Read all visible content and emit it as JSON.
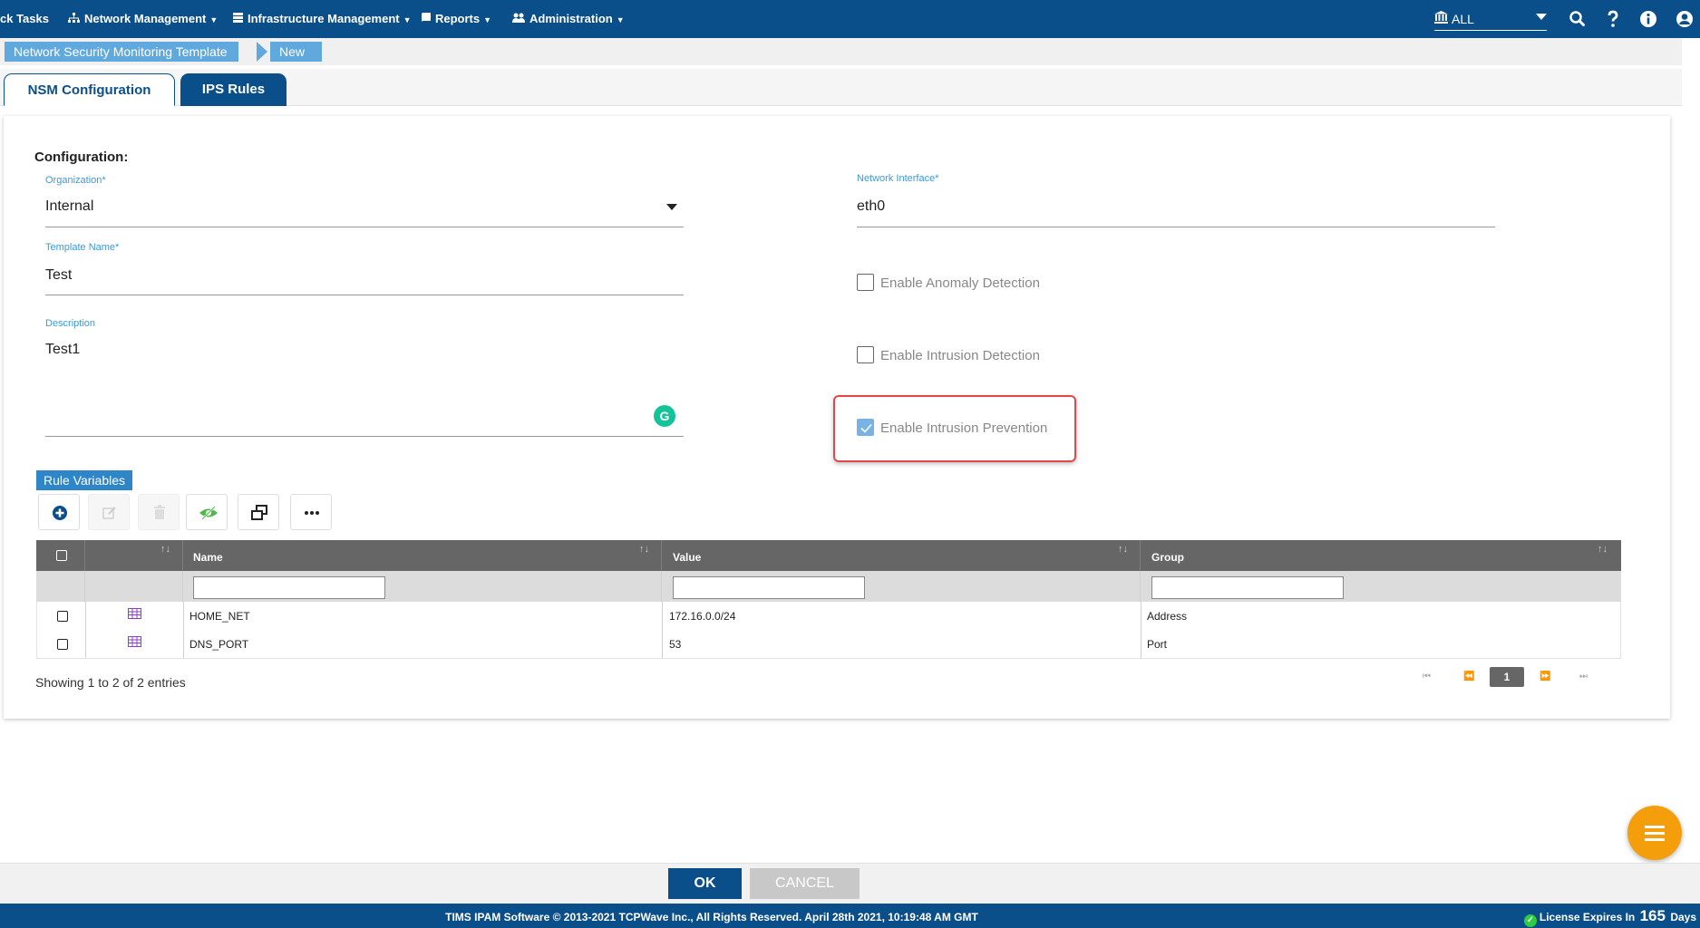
{
  "nav": {
    "items": [
      {
        "label": "ck Tasks",
        "icon": ""
      },
      {
        "label": "Network Management",
        "icon": "sitemap-icon"
      },
      {
        "label": "Infrastructure Management",
        "icon": "server-icon"
      },
      {
        "label": "Reports",
        "icon": "book-icon"
      },
      {
        "label": "Administration",
        "icon": "users-icon"
      }
    ],
    "org_selector": {
      "value": "ALL",
      "icon": "institution-icon"
    },
    "right_icons": [
      "search-icon",
      "help-icon",
      "info-icon",
      "user-icon"
    ]
  },
  "breadcrumb": {
    "items": [
      "Network Security Monitoring Template",
      "New"
    ]
  },
  "tabs": [
    {
      "label": "NSM Configuration",
      "active": true
    },
    {
      "label": "IPS Rules",
      "active": false
    }
  ],
  "form": {
    "section_title": "Configuration:",
    "organization": {
      "label": "Organization*",
      "value": "Internal"
    },
    "template_name": {
      "label": "Template Name*",
      "value": "Test"
    },
    "description": {
      "label": "Description",
      "value": "Test1"
    },
    "network_interface": {
      "label": "Network Interface*",
      "value": "eth0"
    },
    "checkboxes": [
      {
        "label": "Enable Anomaly Detection",
        "checked": false
      },
      {
        "label": "Enable Intrusion Detection",
        "checked": false
      },
      {
        "label": "Enable Intrusion Prevention",
        "checked": true
      }
    ]
  },
  "rule_variables": {
    "title": "Rule Variables",
    "toolbar": [
      "add-icon",
      "edit-icon",
      "delete-icon",
      "visibility-icon",
      "copy-icon",
      "more-icon"
    ],
    "columns": [
      "Name",
      "Value",
      "Group"
    ],
    "rows": [
      {
        "name": "HOME_NET",
        "value": "172.16.0.0/24",
        "group": "Address"
      },
      {
        "name": "DNS_PORT",
        "value": "53",
        "group": "Port"
      }
    ],
    "entries_info": "Showing 1 to 2 of 2 entries",
    "pager": {
      "current_page": "1"
    }
  },
  "actions": {
    "ok_label": "OK",
    "cancel_label": "CANCEL"
  },
  "footer": {
    "text": "TIMS IPAM Software © 2013-2021 TCPWave Inc., All Rights Reserved.  April 28th 2021, 10:19:48 AM GMT",
    "license_prefix": "License Expires In",
    "license_days": "165",
    "license_suffix": "Days"
  },
  "colors": {
    "brand": "#0b4f8a",
    "accent": "#3a9ad9",
    "fab": "#f59e0b",
    "highlight": "#e04848"
  }
}
